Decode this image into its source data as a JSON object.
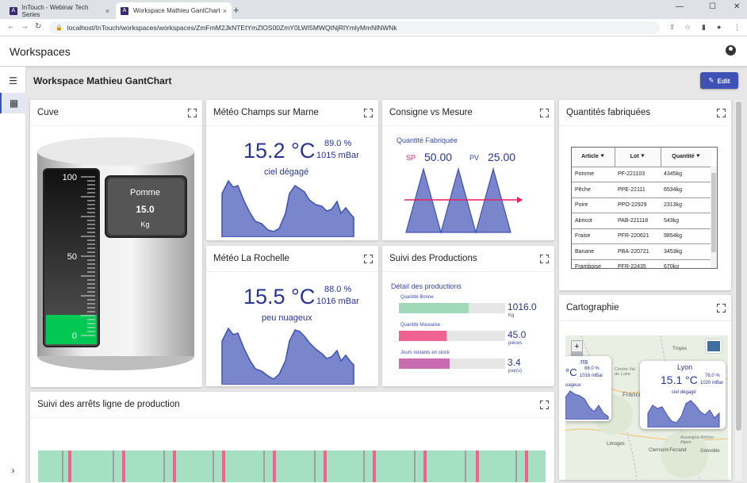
{
  "browser": {
    "tabs": [
      {
        "label": "InTouch - Webinar Tech Series",
        "favicon": "A",
        "close": "×"
      },
      {
        "label": "Workspace Mathieu GantChart",
        "favicon": "A",
        "close": "×"
      }
    ],
    "new_tab": "+",
    "url": "localhost/InTouch/workspaces/workspaces/ZmFmM2JkNTEtYmZlOS00ZmY0LWI5MWQtNjRlYmlyMmNlNWNk"
  },
  "app": {
    "title": "Workspaces"
  },
  "workspace": {
    "title": "Workspace Mathieu GantChart",
    "edit_label": "Edit"
  },
  "cards": {
    "cuve": {
      "title": "Cuve",
      "scale": [
        "100",
        "50",
        "0"
      ],
      "name": "Pomme",
      "value": "15.0",
      "unit": "Kg",
      "level_fraction": 0.15
    },
    "meteo1": {
      "title": "Météo Champs sur Marne",
      "temp": "15.2 °C",
      "humidity": "89.0 %",
      "pressure": "1015 mBar",
      "sky": "ciel dégagé"
    },
    "consigne": {
      "title": "Consigne vs Mesure",
      "subtitle": "Quantité Fabriquée",
      "sp_label": "SP",
      "sp_value": "50.00",
      "pv_label": "PV",
      "pv_value": "25.00"
    },
    "quantites": {
      "title": "Quantités fabriquées",
      "columns": [
        "Article",
        "Lot",
        "Quantité"
      ],
      "rows": [
        [
          "Pomme",
          "PF-221103",
          "4345kg"
        ],
        [
          "Pêche",
          "PPE-22111",
          "6534kg"
        ],
        [
          "Poire",
          "PPO-22929",
          "2313kg"
        ],
        [
          "Abricot",
          "PAB-221118",
          "543kg"
        ],
        [
          "Fraise",
          "PFR-220621",
          "9854kg"
        ],
        [
          "Banane",
          "PBA-220721",
          "3453kg"
        ],
        [
          "Framboise",
          "PFR-22435",
          "670kg"
        ]
      ]
    },
    "meteo2": {
      "title": "Météo La Rochelle",
      "temp": "15.5 °C",
      "humidity": "88.0 %",
      "pressure": "1016 mBar",
      "sky": "peu nuageux"
    },
    "suivi": {
      "title": "Suivi des Productions",
      "subtitle": "Détail des productions",
      "bars": [
        {
          "label": "Quantité Bonne",
          "value": "1016.0",
          "unit": "Kg",
          "fraction": 0.66,
          "color": "#9fd9b8"
        },
        {
          "label": "Quantité Mauvaise",
          "value": "45.0",
          "unit": "pièces",
          "fraction": 0.45,
          "color": "#f06292"
        },
        {
          "label": "Jours restants en stock",
          "value": "3.4",
          "unit": "jour(s)",
          "fraction": 0.48,
          "color": "#c86bb0"
        }
      ]
    },
    "carto": {
      "title": "Cartographie",
      "zoom_in": "+",
      "zoom_out": "−",
      "cities": [
        "Troyes",
        "Centre-Val de Loire",
        "France",
        "Limoges",
        "Clermont-Ferrand",
        "Grenoble",
        "Auvergne-Rhône-Alpes"
      ],
      "popup_left": {
        "city": "ns",
        "temp": "°C",
        "humidity": "88.0 %",
        "pressure": "1016 mBar",
        "sky": "uageux"
      },
      "popup_right": {
        "city": "Lyon",
        "temp": "15.1 °C",
        "humidity": "76.0 %",
        "pressure": "1020 mBar",
        "sky": "ciel dégagé"
      }
    },
    "arrets": {
      "title": "Suivi des arrêts ligne de production"
    }
  },
  "colors": {
    "accent": "#3f51b5",
    "chart_fill": "#7986cb",
    "chart_stroke": "#3f51b5",
    "gauge_green": "#00c853",
    "alarm_red": "#e91e63",
    "run_green": "#a5e0c3"
  }
}
